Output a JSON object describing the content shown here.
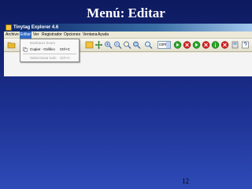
{
  "slide": {
    "title": "Menú: Editar",
    "page_number": "12"
  },
  "window": {
    "title": "Tinytag Explorer 4.6"
  },
  "menubar": {
    "items": [
      "Archivo",
      "Editar",
      "Ver",
      "Registrador",
      "Opciones",
      "Ventana",
      "Ayuda"
    ],
    "active": "Editar"
  },
  "toolbar": {
    "zoom_value": "com0"
  },
  "edit_menu": {
    "items": [
      {
        "label": "Deshacer Zoom",
        "shortcut": "",
        "enabled": false
      },
      {
        "label": "Copiar - Gráfico",
        "shortcut": "Ctrl+C",
        "enabled": true
      },
      {
        "label": "Seleccionar todo",
        "shortcut": "Ctrl+A",
        "enabled": false
      }
    ]
  },
  "colors": {
    "menu_highlight": "#316ac5",
    "disabled_text": "#9a9a9a"
  }
}
